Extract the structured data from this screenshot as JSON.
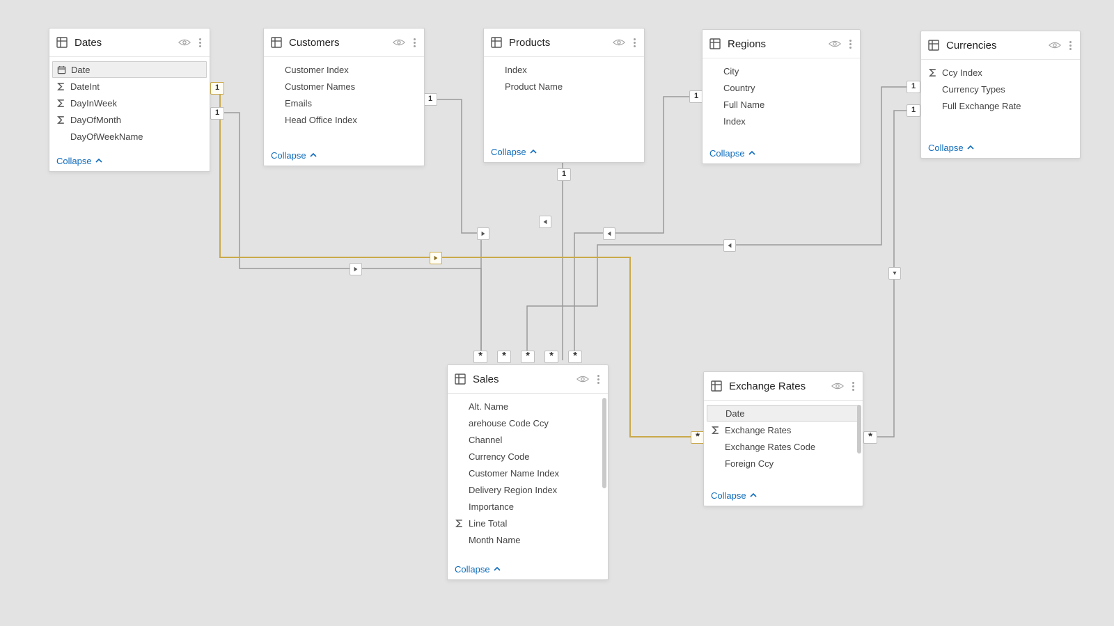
{
  "labels": {
    "collapse": "Collapse"
  },
  "cardinality": {
    "one": "1",
    "many": "*"
  },
  "tables": {
    "dates": {
      "title": "Dates",
      "fields": [
        {
          "name": "Date",
          "icon": "calendar",
          "selected": true
        },
        {
          "name": "DateInt",
          "icon": "sigma"
        },
        {
          "name": "DayInWeek",
          "icon": "sigma"
        },
        {
          "name": "DayOfMonth",
          "icon": "sigma"
        },
        {
          "name": "DayOfWeekName",
          "icon": ""
        }
      ]
    },
    "customers": {
      "title": "Customers",
      "fields": [
        {
          "name": "Customer Index",
          "icon": ""
        },
        {
          "name": "Customer Names",
          "icon": ""
        },
        {
          "name": "Emails",
          "icon": ""
        },
        {
          "name": "Head Office Index",
          "icon": ""
        }
      ]
    },
    "products": {
      "title": "Products",
      "fields": [
        {
          "name": "Index",
          "icon": ""
        },
        {
          "name": "Product Name",
          "icon": ""
        }
      ]
    },
    "regions": {
      "title": "Regions",
      "fields": [
        {
          "name": "City",
          "icon": ""
        },
        {
          "name": "Country",
          "icon": ""
        },
        {
          "name": "Full Name",
          "icon": ""
        },
        {
          "name": "Index",
          "icon": ""
        }
      ]
    },
    "currencies": {
      "title": "Currencies",
      "fields": [
        {
          "name": "Ccy Index",
          "icon": "sigma"
        },
        {
          "name": "Currency Types",
          "icon": ""
        },
        {
          "name": "Full Exchange Rate",
          "icon": ""
        }
      ]
    },
    "sales": {
      "title": "Sales",
      "fields": [
        {
          "name": "Alt. Name",
          "icon": ""
        },
        {
          "name": "arehouse Code Ccy",
          "icon": ""
        },
        {
          "name": "Channel",
          "icon": ""
        },
        {
          "name": "Currency Code",
          "icon": ""
        },
        {
          "name": "Customer Name Index",
          "icon": ""
        },
        {
          "name": "Delivery Region Index",
          "icon": ""
        },
        {
          "name": "Importance",
          "icon": ""
        },
        {
          "name": "Line Total",
          "icon": "sigma"
        },
        {
          "name": "Month Name",
          "icon": ""
        }
      ]
    },
    "exchange": {
      "title": "Exchange Rates",
      "fields": [
        {
          "name": "Date",
          "icon": "",
          "selected": true
        },
        {
          "name": "Exchange Rates",
          "icon": "sigma"
        },
        {
          "name": "Exchange Rates Code",
          "icon": ""
        },
        {
          "name": "Foreign Ccy",
          "icon": ""
        }
      ]
    }
  },
  "relationships": [
    {
      "from": "dates",
      "to": "sales",
      "fromCard": "1",
      "toCard": "*",
      "active": false
    },
    {
      "from": "dates",
      "to": "exchange",
      "fromCard": "1",
      "toCard": "*",
      "active": true
    },
    {
      "from": "customers",
      "to": "sales",
      "fromCard": "1",
      "toCard": "*",
      "active": false
    },
    {
      "from": "products",
      "to": "sales",
      "fromCard": "1",
      "toCard": "*",
      "active": false
    },
    {
      "from": "regions",
      "to": "sales",
      "fromCard": "1",
      "toCard": "*",
      "active": false
    },
    {
      "from": "currencies",
      "to": "sales",
      "fromCard": "1",
      "toCard": "*",
      "active": false
    },
    {
      "from": "currencies",
      "to": "exchange",
      "fromCard": "1",
      "toCard": "*",
      "active": false
    }
  ]
}
